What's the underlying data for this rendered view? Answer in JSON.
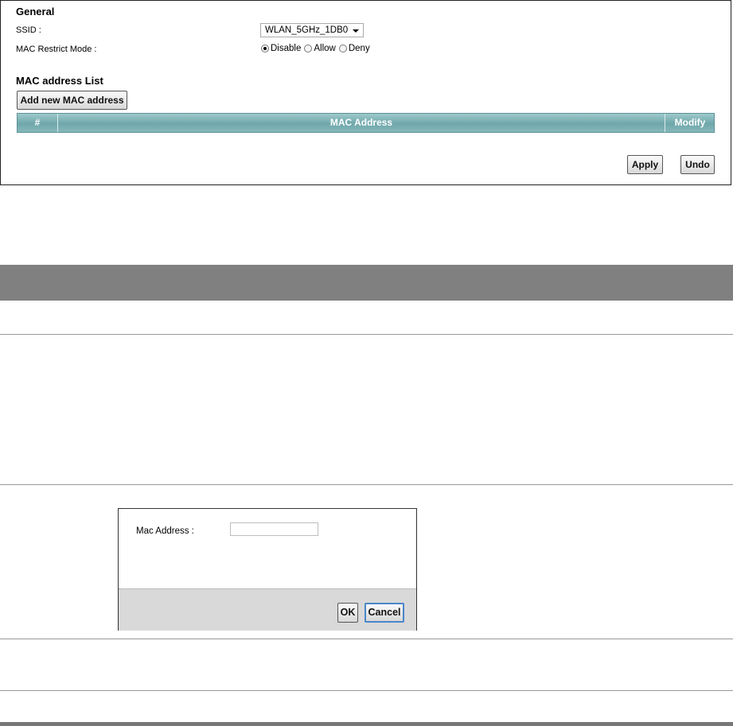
{
  "general": {
    "heading": "General",
    "ssid_label": "SSID :",
    "ssid_value": "WLAN_5GHz_1DB0",
    "mac_mode_label": "MAC Restrict Mode :",
    "mac_mode_options": [
      "Disable",
      "Allow",
      "Deny"
    ],
    "mac_mode_selected": "Disable"
  },
  "mac_list": {
    "heading": "MAC address List",
    "add_button": "Add new MAC address",
    "columns": [
      "#",
      "MAC Address",
      "Modify"
    ],
    "rows": []
  },
  "actions": {
    "apply": "Apply",
    "undo": "Undo"
  },
  "dialog": {
    "mac_label": "Mac Address :",
    "mac_value": "",
    "ok": "OK",
    "cancel": "Cancel"
  },
  "colors": {
    "table_header": "#7fb3b6",
    "frame_band": "#808080",
    "dialog_footer": "#d9d9d9"
  }
}
